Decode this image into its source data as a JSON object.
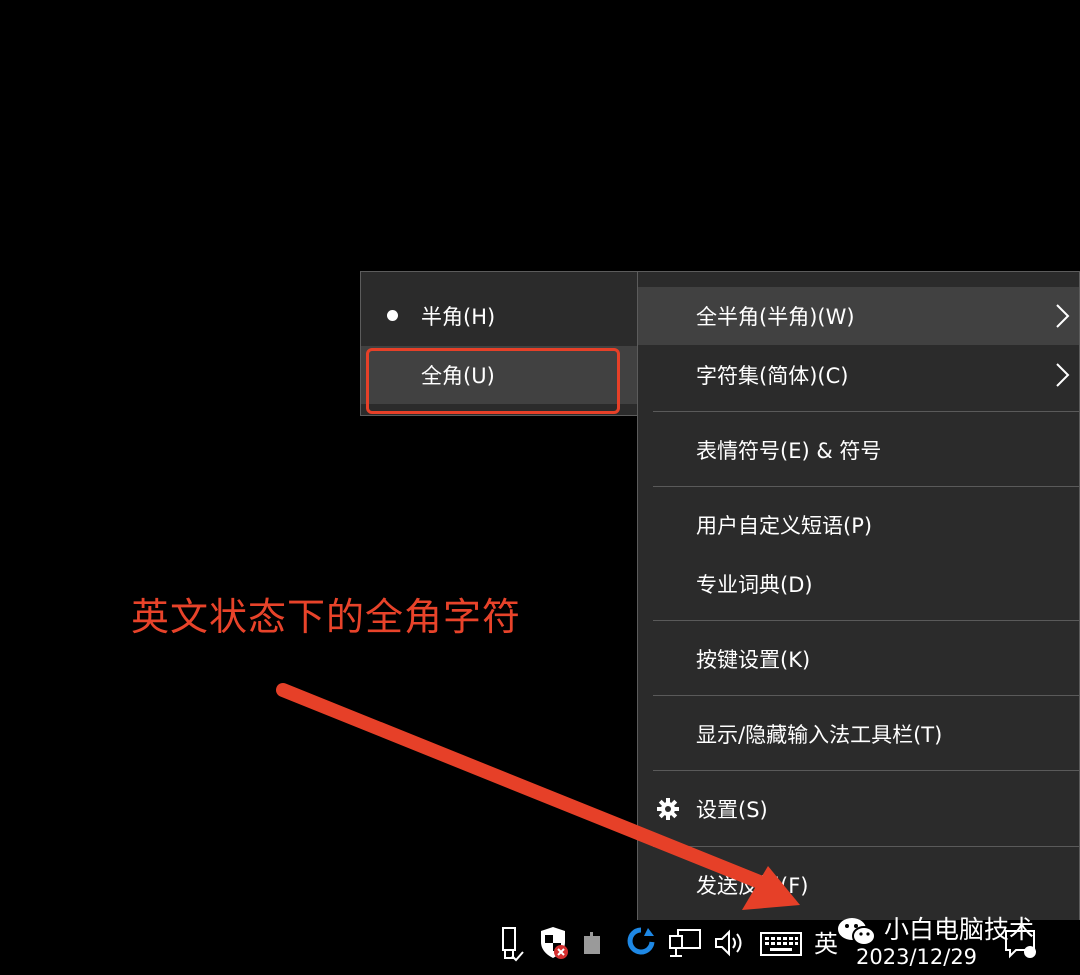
{
  "submenu": {
    "items": [
      {
        "label": "半角(H)",
        "selected": true
      },
      {
        "label": "全角(U)",
        "selected": false
      }
    ]
  },
  "mainmenu": {
    "items": [
      {
        "label": "全半角(半角)(W)"
      },
      {
        "label": "字符集(简体)(C)"
      },
      {
        "label": "表情符号(E) & 符号"
      },
      {
        "label": "用户自定义短语(P)"
      },
      {
        "label": "专业词典(D)"
      },
      {
        "label": "按键设置(K)"
      },
      {
        "label": "显示/隐藏输入法工具栏(T)"
      },
      {
        "label": "设置(S)"
      },
      {
        "label": "发送反馈(F)"
      }
    ]
  },
  "annotation": {
    "text": "英文状态下的全角字符",
    "color": "#e8432a"
  },
  "taskbar": {
    "ime_indicator": "英",
    "date": "2023/12/29",
    "icons": [
      "usb-icon",
      "security-icon",
      "app-icon",
      "sync-icon",
      "network-icon",
      "volume-icon",
      "keyboard-icon",
      "notification-icon"
    ]
  },
  "watermark": {
    "text": "小白电脑技术"
  },
  "colors": {
    "menu_bg": "#2b2b2b",
    "highlight": "#414141",
    "accent_red": "#e64028"
  }
}
